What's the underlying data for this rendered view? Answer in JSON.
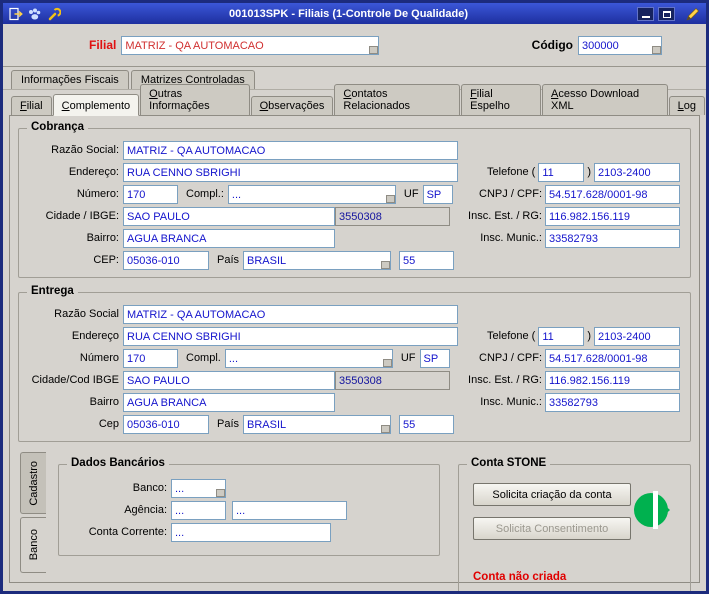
{
  "window": {
    "title": "001013SPK - Filiais (1-Controle De Qualidade)"
  },
  "header": {
    "filial_label": "Filial",
    "filial_value": "MATRIZ - QA AUTOMACAO",
    "codigo_label": "Código",
    "codigo_value": "300000"
  },
  "folder_tabs": [
    {
      "label": "Informações Fiscais"
    },
    {
      "label": "Matrizes Controladas"
    }
  ],
  "main_tabs": [
    {
      "label": "Filial"
    },
    {
      "label": "Complemento"
    },
    {
      "label": "Outras Informações"
    },
    {
      "label": "Observações"
    },
    {
      "label": "Contatos Relacionados"
    },
    {
      "label": "Filial Espelho"
    },
    {
      "label": "Acesso Download XML"
    },
    {
      "label": "Log"
    }
  ],
  "active_main_tab": "Complemento",
  "cobranca": {
    "title": "Cobrança",
    "labels": {
      "razao": "Razão Social:",
      "endereco": "Endereço:",
      "numero": "Número:",
      "compl": "Compl.:",
      "uf": "UF",
      "cidade": "Cidade / IBGE:",
      "bairro": "Bairro:",
      "cep": "CEP:",
      "pais": "País",
      "fone_open": "Telefone (",
      "fone_close": ")",
      "cnpj": "CNPJ / CPF:",
      "insc_est": "Insc. Est. / RG:",
      "insc_mun": "Insc. Munic.:"
    },
    "values": {
      "razao": "MATRIZ - QA AUTOMACAO",
      "endereco": "RUA CENNO SBRIGHI",
      "numero": "170",
      "compl": "...",
      "uf": "SP",
      "cidade": "SAO PAULO",
      "ibge": "3550308",
      "bairro": "AGUA BRANCA",
      "cep": "05036-010",
      "pais": "BRASIL",
      "ddi": "55",
      "ddd": "11",
      "fone": "2103-2400",
      "cnpj": "54.517.628/0001-98",
      "insc_est": "116.982.156.119",
      "insc_mun": "33582793"
    }
  },
  "entrega": {
    "title": "Entrega",
    "labels": {
      "razao": "Razão Social",
      "endereco": "Endereço",
      "numero": "Número",
      "compl": "Compl.",
      "uf": "UF",
      "cidade": "Cidade/Cod IBGE",
      "bairro": "Bairro",
      "cep": "Cep",
      "pais": "País",
      "fone_open": "Telefone (",
      "fone_close": ")",
      "cnpj": "CNPJ / CPF:",
      "insc_est": "Insc. Est. / RG:",
      "insc_mun": "Insc. Munic.:"
    },
    "values": {
      "razao": "MATRIZ - QA AUTOMACAO",
      "endereco": "RUA CENNO SBRIGHI",
      "numero": "170",
      "compl": "...",
      "uf": "SP",
      "cidade": "SAO PAULO",
      "ibge": "3550308",
      "bairro": "AGUA BRANCA",
      "cep": "05036-010",
      "pais": "BRASIL",
      "ddi": "55",
      "ddd": "11",
      "fone": "2103-2400",
      "cnpj": "54.517.628/0001-98",
      "insc_est": "116.982.156.119",
      "insc_mun": "33582793"
    }
  },
  "side_tabs": [
    {
      "label": "Cadastro"
    },
    {
      "label": "Banco"
    }
  ],
  "active_side_tab": "Banco",
  "dados_bancarios": {
    "title": "Dados Bancários",
    "labels": {
      "banco": "Banco:",
      "agencia": "Agência:",
      "conta": "Conta Corrente:"
    },
    "values": {
      "banco": "...",
      "agencia": "...",
      "agencia_dv": "...",
      "conta": "..."
    }
  },
  "conta_stone": {
    "title": "Conta STONE",
    "create_button": "Solicita criação da conta",
    "consent_button": "Solicita Consentimento",
    "status": "Conta não criada"
  },
  "colors": {
    "titlebar_blue": "#1e2f9f",
    "field_text_blue": "#1414cc",
    "alert_red": "#e00000",
    "stone_green": "#00b14f"
  },
  "icons": {
    "titlebar_left": [
      "exit-icon",
      "app-icon",
      "wrench-icon"
    ],
    "titlebar_right": [
      "minimize-icon",
      "maximize-icon",
      "edit-pencil-icon"
    ],
    "field_lookup": "lookup-icon"
  }
}
